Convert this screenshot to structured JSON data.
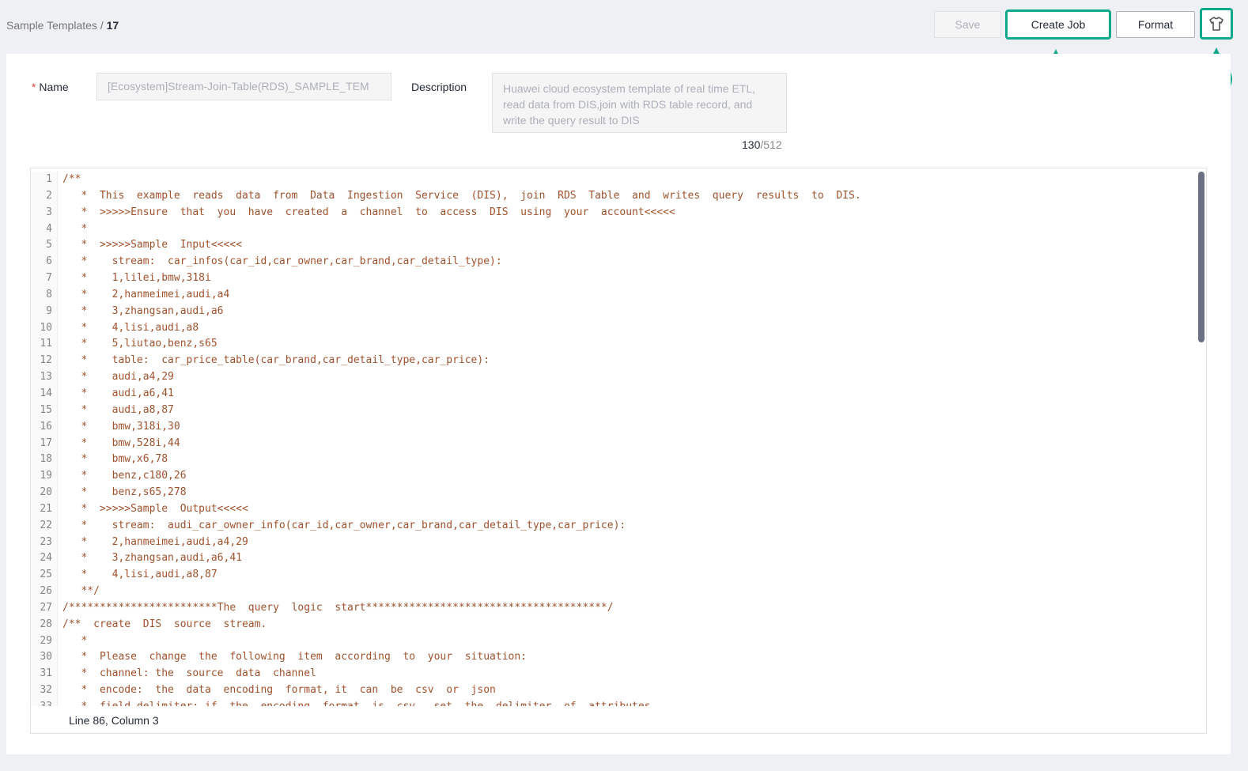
{
  "breadcrumb": {
    "parent": "Sample Templates",
    "separator": "/",
    "current": "17"
  },
  "toolbar": {
    "save": "Save",
    "create_job": "Create Job",
    "format": "Format",
    "theme_icon": "shirt-icon"
  },
  "markers": {
    "a": "a",
    "b": "b"
  },
  "accent": "#10a88a",
  "form": {
    "name_label": "Name",
    "required": "*",
    "name_value": "[Ecosystem]Stream-Join-Table(RDS)_SAMPLE_TEM",
    "description_label": "Description",
    "description_value": "Huawei cloud ecosystem template of real time ETL, read data from DIS,join with RDS table record, and write the query result to DIS",
    "char_count": "130",
    "char_max": "/512"
  },
  "editor": {
    "lines": [
      "/**",
      "   *  This  example  reads  data  from  Data  Ingestion  Service  (DIS),  join  RDS  Table  and  writes  query  results  to  DIS.",
      "   *  >>>>>Ensure  that  you  have  created  a  channel  to  access  DIS  using  your  account<<<<<",
      "   *",
      "   *  >>>>>Sample  Input<<<<<",
      "   *    stream:  car_infos(car_id,car_owner,car_brand,car_detail_type):",
      "   *    1,lilei,bmw,318i",
      "   *    2,hanmeimei,audi,a4",
      "   *    3,zhangsan,audi,a6",
      "   *    4,lisi,audi,a8",
      "   *    5,liutao,benz,s65",
      "   *    table:  car_price_table(car_brand,car_detail_type,car_price):",
      "   *    audi,a4,29",
      "   *    audi,a6,41",
      "   *    audi,a8,87",
      "   *    bmw,318i,30",
      "   *    bmw,528i,44",
      "   *    bmw,x6,78",
      "   *    benz,c180,26",
      "   *    benz,s65,278",
      "   *  >>>>>Sample  Output<<<<<",
      "   *    stream:  audi_car_owner_info(car_id,car_owner,car_brand,car_detail_type,car_price):",
      "   *    2,hanmeimei,audi,a4,29",
      "   *    3,zhangsan,audi,a6,41",
      "   *    4,lisi,audi,a8,87",
      "   **/",
      "/************************The  query  logic  start***************************************/",
      "/**  create  DIS  source  stream.",
      "   *",
      "   *  Please  change  the  following  item  according  to  your  situation:",
      "   *  channel: the  source  data  channel",
      "   *  encode:  the  data  encoding  format, it  can  be  csv  or  json",
      "   *  field_delimiter: if  the  encoding  format  is  csv,  set  the  delimiter  of  attributes"
    ],
    "status": "Line 86, Column 3"
  }
}
